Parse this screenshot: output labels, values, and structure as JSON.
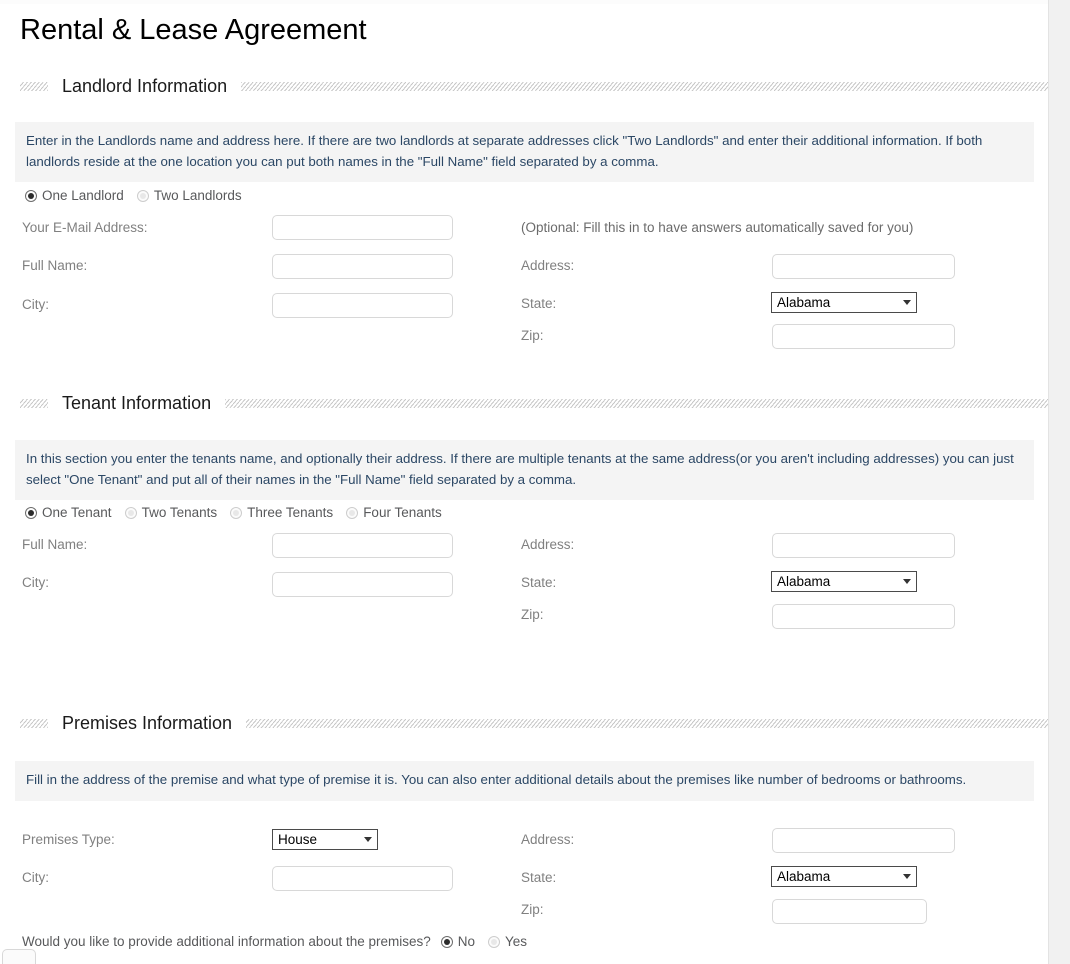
{
  "page": {
    "title": "Rental & Lease Agreement"
  },
  "sections": {
    "landlord": {
      "heading": "Landlord Information",
      "info": "Enter in the Landlords name and address here. If there are two landlords at separate addresses click \"Two Landlords\" and enter their additional information. If both landlords reside at the one location you can put both names in the \"Full Name\" field separated by a comma.",
      "count_options": [
        {
          "label": "One Landlord",
          "selected": true
        },
        {
          "label": "Two Landlords",
          "selected": false
        }
      ],
      "fields": {
        "email_label": "Your E-Mail Address:",
        "email_value": "",
        "email_note": "(Optional: Fill this in to have answers automatically saved for you)",
        "fullname_label": "Full Name:",
        "fullname_value": "",
        "city_label": "City:",
        "city_value": "",
        "address_label": "Address:",
        "address_value": "",
        "state_label": "State:",
        "state_value": "Alabama",
        "zip_label": "Zip:",
        "zip_value": ""
      }
    },
    "tenant": {
      "heading": "Tenant Information",
      "info": "In this section you enter the tenants name, and optionally their address. If there are multiple tenants at the same address(or you aren't including addresses) you can just select \"One Tenant\" and put all of their names in the \"Full Name\" field separated by a comma.",
      "count_options": [
        {
          "label": "One Tenant",
          "selected": true
        },
        {
          "label": "Two Tenants",
          "selected": false
        },
        {
          "label": "Three Tenants",
          "selected": false
        },
        {
          "label": "Four Tenants",
          "selected": false
        }
      ],
      "fields": {
        "fullname_label": "Full Name:",
        "fullname_value": "",
        "city_label": "City:",
        "city_value": "",
        "address_label": "Address:",
        "address_value": "",
        "state_label": "State:",
        "state_value": "Alabama",
        "zip_label": "Zip:",
        "zip_value": ""
      }
    },
    "premises": {
      "heading": "Premises Information",
      "info": "Fill in the address of the premise and what type of premise it is. You can also enter additional details about the premises like number of bedrooms or bathrooms.",
      "fields": {
        "type_label": "Premises Type:",
        "type_value": "House",
        "city_label": "City:",
        "city_value": "",
        "address_label": "Address:",
        "address_value": "",
        "state_label": "State:",
        "state_value": "Alabama",
        "zip_label": "Zip:",
        "zip_value": ""
      },
      "additional_question": "Would you like to provide additional information about the premises?",
      "additional_options": [
        {
          "label": "No",
          "selected": true
        },
        {
          "label": "Yes",
          "selected": false
        }
      ]
    }
  },
  "colors": {
    "info_text": "#2b4765",
    "info_bg": "#f4f4f4",
    "label": "#808080",
    "title": "#000000"
  }
}
